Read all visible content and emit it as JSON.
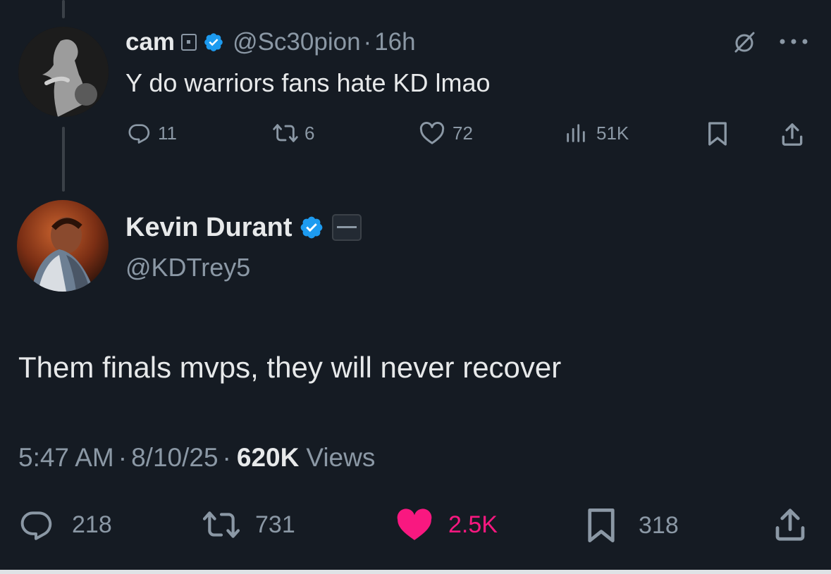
{
  "reply_parent": {
    "author": {
      "display_name": "cam",
      "handle": "@Sc30pion",
      "verified": true
    },
    "separator": "·",
    "time_ago": "16h",
    "text": "Y do warriors fans hate KD lmao",
    "actions": {
      "replies": "11",
      "reposts": "6",
      "likes": "72",
      "views": "51K"
    }
  },
  "main_tweet": {
    "author": {
      "display_name": "Kevin Durant",
      "handle": "@KDTrey5",
      "verified": true
    },
    "text": "Them finals mvps, they will never recover",
    "meta": {
      "time": "5:47 AM",
      "separator": "·",
      "date": "8/10/25",
      "views_count": "620K",
      "views_label": "Views"
    },
    "actions": {
      "replies": "218",
      "reposts": "731",
      "likes": "2.5K",
      "bookmarks": "318",
      "liked": true
    }
  },
  "colors": {
    "background": "#151b23",
    "text": "#e7e9ea",
    "muted": "#8b98a5",
    "verified": "#1d9bf0",
    "like_active": "#f91880"
  },
  "icons": {
    "reply": "reply-icon",
    "repost": "repost-icon",
    "like": "heart-icon",
    "views": "views-icon",
    "bookmark": "bookmark-icon",
    "share": "share-icon",
    "grok": "grok-icon",
    "more": "more-icon"
  }
}
